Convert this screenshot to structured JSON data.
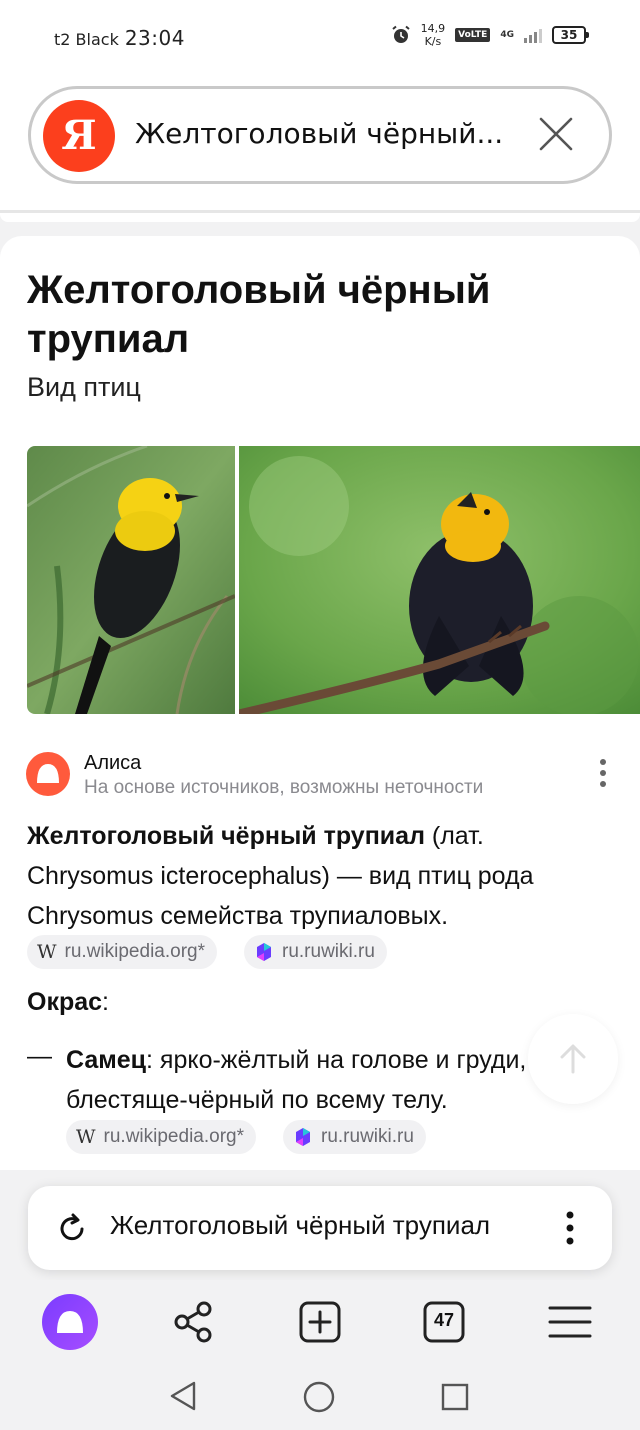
{
  "status_bar": {
    "carrier": "t2 Black",
    "time": "23:04",
    "net_speed_value": "14,9",
    "net_speed_unit": "K/s",
    "volte": "VoLTE",
    "network": "4G",
    "battery": "35"
  },
  "search": {
    "query": "Желтоголовый чёрный...",
    "logo_letter": "Я",
    "icons": {
      "logo": "yandex-logo",
      "clear": "close-icon"
    }
  },
  "entity": {
    "title": "Желтоголовый чёрный трупиал",
    "subtitle": "Вид птиц"
  },
  "alice": {
    "name": "Алиса",
    "note": "На основе источников, возможны неточности"
  },
  "answer": {
    "bold": "Желтоголовый чёрный трупиал",
    "rest": " (лат. Chrysomus icterocephalus) — вид птиц рода Chrysomus семейства трупиаловых."
  },
  "sources_1": [
    {
      "label": "ru.wikipedia.org*",
      "icon": "wikipedia-icon"
    },
    {
      "label": "ru.ruwiki.ru",
      "icon": "ruwiki-icon"
    }
  ],
  "section": {
    "heading": "Окрас",
    "colon": ":"
  },
  "bullet": {
    "dash": "—",
    "bold": "Самец",
    "rest": ": ярко-жёлтый на голове и груди, блестяще-чёрный по всему телу."
  },
  "sources_2": [
    {
      "label": "ru.wikipedia.org*",
      "icon": "wikipedia-icon"
    },
    {
      "label": "ru.ruwiki.ru",
      "icon": "ruwiki-icon"
    }
  ],
  "query_bar": {
    "text": "Желтоголовый чёрный трупиал"
  },
  "bottom_nav": {
    "tabs_count": "47"
  },
  "colors": {
    "yandex_red": "#fc3f1d",
    "alice_purple": "#8a3dff",
    "muted_text": "#8a8a8f"
  }
}
